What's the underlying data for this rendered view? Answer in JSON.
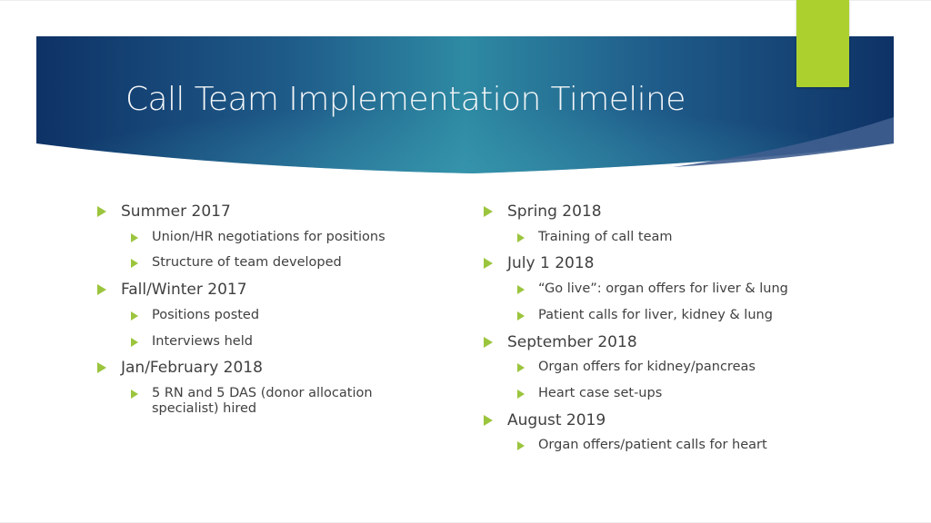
{
  "slide": {
    "title": "Call Team Implementation Timeline",
    "colors": {
      "banner_dark": "#0e3266",
      "banner_mid": "#1f5c8a",
      "banner_light": "#2e8aa3",
      "banner_overlay": "#3f5e8f",
      "accent_green": "#acd12f",
      "bullet_green": "#9bc53d",
      "title_text": "#f4f6f8",
      "body_text": "#404040"
    },
    "left_column": [
      {
        "label": "Summer 2017",
        "children": [
          "Union/HR negotiations for positions",
          "Structure of team developed"
        ]
      },
      {
        "label": "Fall/Winter 2017",
        "children": [
          "Positions posted",
          "Interviews held"
        ]
      },
      {
        "label": "Jan/February 2018",
        "children": [
          "5 RN and 5 DAS (donor allocation specialist) hired"
        ]
      }
    ],
    "right_column": [
      {
        "label": "Spring 2018",
        "children": [
          "Training of call team"
        ]
      },
      {
        "label": "July 1 2018",
        "children": [
          "“Go live”: organ offers for liver & lung",
          "Patient calls for liver, kidney & lung"
        ]
      },
      {
        "label": "September 2018",
        "children": [
          "Organ offers for kidney/pancreas",
          "Heart case set-ups"
        ]
      },
      {
        "label": "August 2019",
        "children": [
          "Organ offers/patient calls for heart"
        ]
      }
    ]
  }
}
